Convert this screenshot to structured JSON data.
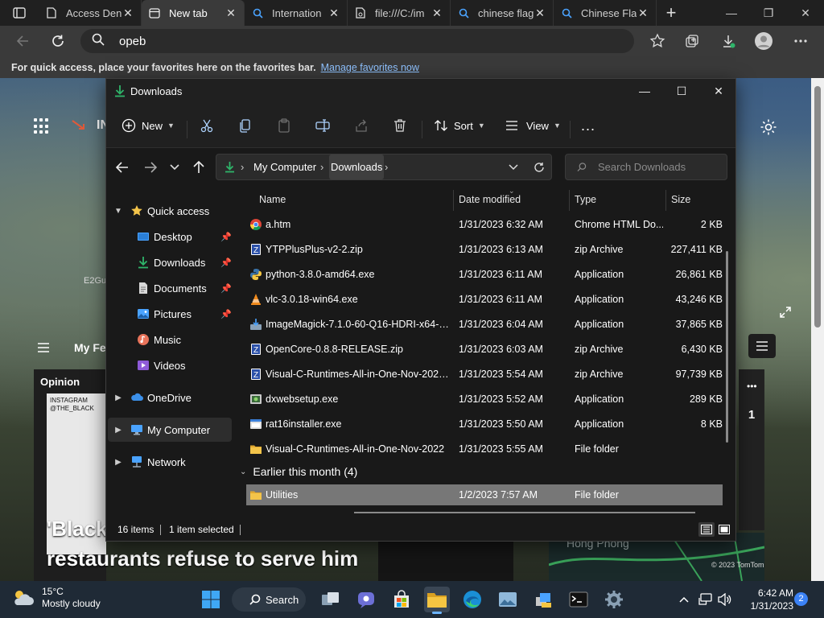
{
  "browser": {
    "tabs": [
      {
        "label": "Access Den",
        "icon": "document-icon",
        "active": false
      },
      {
        "label": "New tab",
        "icon": "newtab-icon",
        "active": true
      },
      {
        "label": "Internation",
        "icon": "search-icon",
        "active": false
      },
      {
        "label": "file:///C:/im",
        "icon": "file-icon",
        "active": false
      },
      {
        "label": "chinese flag",
        "icon": "search-icon",
        "active": false
      },
      {
        "label": "Chinese Fla",
        "icon": "search-icon",
        "active": false
      }
    ],
    "address": "opeb",
    "favorites_bar": {
      "text": "For quick access, place your favorites here on the favorites bar.",
      "link": "Manage favorites now"
    }
  },
  "ntp": {
    "fragments": {
      "top_letters": "IN",
      "caption": "E2Gu",
      "feed_label": "My Fe",
      "opinion": "Opinion",
      "insta": "INSTAGRAM\n@THE_BLACK",
      "page_num": "1",
      "map_label": "Hong Phong",
      "map_copy": "© 2023 TomTom"
    },
    "headline_line1": "'Black",
    "headline_line2": "restaurants refuse to serve him"
  },
  "explorer": {
    "title": "Downloads",
    "commands": {
      "new": "New",
      "sort": "Sort",
      "view": "View",
      "more": "..."
    },
    "breadcrumb": [
      "My Computer",
      "Downloads"
    ],
    "search_placeholder": "Search Downloads",
    "nav": [
      {
        "label": "Quick access",
        "icon": "star-icon",
        "level": 0,
        "expanded": true
      },
      {
        "label": "Desktop",
        "icon": "desktop-icon",
        "level": 1,
        "pinned": true
      },
      {
        "label": "Downloads",
        "icon": "download-icon",
        "level": 1,
        "pinned": true
      },
      {
        "label": "Documents",
        "icon": "documents-icon",
        "level": 1,
        "pinned": true
      },
      {
        "label": "Pictures",
        "icon": "pictures-icon",
        "level": 1,
        "pinned": true
      },
      {
        "label": "Music",
        "icon": "music-icon",
        "level": 1,
        "pinned": false
      },
      {
        "label": "Videos",
        "icon": "videos-icon",
        "level": 1,
        "pinned": false
      },
      {
        "label": "OneDrive",
        "icon": "cloud-icon",
        "level": 0,
        "expanded": false
      },
      {
        "label": "My Computer",
        "icon": "computer-icon",
        "level": 0,
        "expanded": false,
        "selected": true
      },
      {
        "label": "Network",
        "icon": "network-icon",
        "level": 0,
        "expanded": false
      }
    ],
    "columns": {
      "name": "Name",
      "date": "Date modified",
      "type": "Type",
      "size": "Size"
    },
    "files": [
      {
        "name": "a.htm",
        "date": "1/31/2023 6:32 AM",
        "type": "Chrome HTML Do...",
        "size": "2 KB",
        "icon": "chrome-icon"
      },
      {
        "name": "YTPPlusPlus-v2-2.zip",
        "date": "1/31/2023 6:13 AM",
        "type": "zip Archive",
        "size": "227,411 KB",
        "icon": "zip-icon"
      },
      {
        "name": "python-3.8.0-amd64.exe",
        "date": "1/31/2023 6:11 AM",
        "type": "Application",
        "size": "26,861 KB",
        "icon": "python-icon"
      },
      {
        "name": "vlc-3.0.18-win64.exe",
        "date": "1/31/2023 6:11 AM",
        "type": "Application",
        "size": "43,246 KB",
        "icon": "vlc-icon"
      },
      {
        "name": "ImageMagick-7.1.0-60-Q16-HDRI-x64-dll...",
        "date": "1/31/2023 6:04 AM",
        "type": "Application",
        "size": "37,865 KB",
        "icon": "installer-icon"
      },
      {
        "name": "OpenCore-0.8.8-RELEASE.zip",
        "date": "1/31/2023 6:03 AM",
        "type": "zip Archive",
        "size": "6,430 KB",
        "icon": "zip-icon"
      },
      {
        "name": "Visual-C-Runtimes-All-in-One-Nov-2022...",
        "date": "1/31/2023 5:54 AM",
        "type": "zip Archive",
        "size": "97,739 KB",
        "icon": "zip-icon"
      },
      {
        "name": "dxwebsetup.exe",
        "date": "1/31/2023 5:52 AM",
        "type": "Application",
        "size": "289 KB",
        "icon": "setup-icon"
      },
      {
        "name": "rat16installer.exe",
        "date": "1/31/2023 5:50 AM",
        "type": "Application",
        "size": "8 KB",
        "icon": "app-icon"
      },
      {
        "name": "Visual-C-Runtimes-All-in-One-Nov-2022",
        "date": "1/31/2023 5:55 AM",
        "type": "File folder",
        "size": "",
        "icon": "folder-icon"
      }
    ],
    "group_earlier": "Earlier this month (4)",
    "earlier_files": [
      {
        "name": "Utilities",
        "date": "1/2/2023 7:57 AM",
        "type": "File folder",
        "size": "",
        "icon": "folder-icon",
        "selected": true
      }
    ],
    "status": {
      "count": "16 items",
      "selection": "1 item selected"
    }
  },
  "taskbar": {
    "weather_temp": "15°C",
    "weather_desc": "Mostly cloudy",
    "search_label": "Search",
    "time": "6:42 AM",
    "date": "1/31/2023",
    "notifications": "2"
  },
  "colors": {
    "accent": "#3b82f6",
    "selection": "#777777",
    "folder": "#f3c44a",
    "download_green": "#2fb56a"
  }
}
